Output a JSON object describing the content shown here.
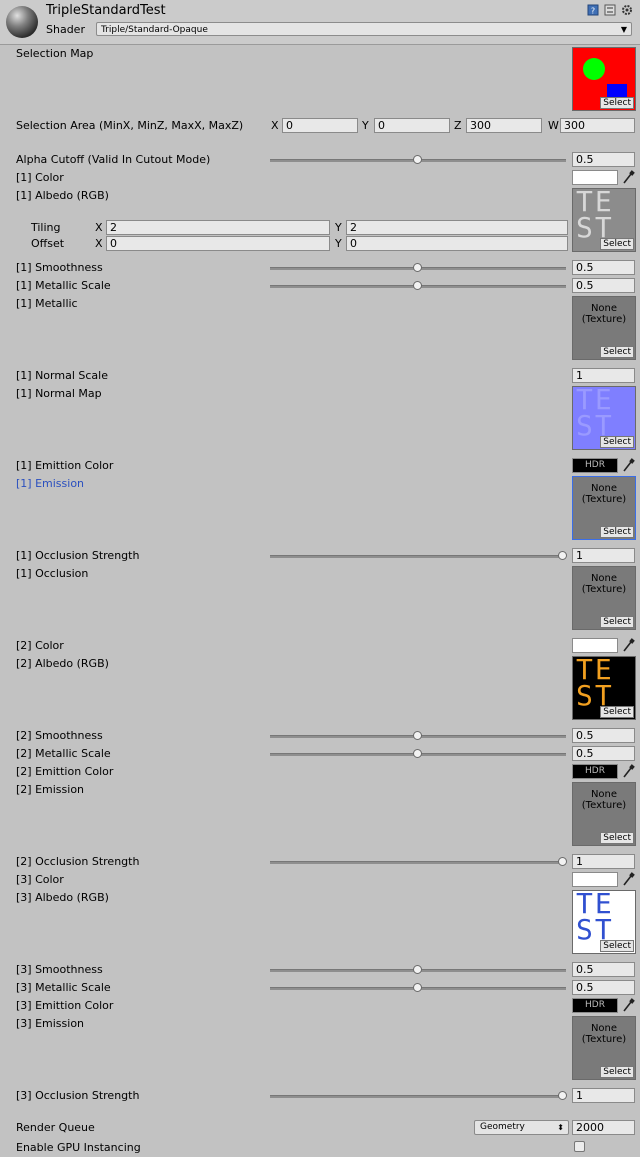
{
  "header": {
    "title": "TripleStandardTest",
    "shader_label": "Shader",
    "shader_value": "Triple/Standard-Opaque"
  },
  "selection_map": {
    "label": "Selection Map",
    "select": "Select"
  },
  "selection_area": {
    "label": "Selection Area (MinX, MinZ, MaxX, MaxZ)",
    "x_axis": "X",
    "x": "0",
    "y_axis": "Y",
    "y": "0",
    "z_axis": "Z",
    "z": "300",
    "w_axis": "W",
    "w": "300"
  },
  "alpha_cutoff": {
    "label": "Alpha Cutoff (Valid In Cutout Mode)",
    "value": "0.5",
    "fraction": 0.5
  },
  "tex_none": "None",
  "tex_texture": "(Texture)",
  "select_label": "Select",
  "hdr_label": "HDR",
  "tiling": {
    "label": "Tiling",
    "x_axis": "X",
    "x": "2",
    "y_axis": "Y",
    "y": "2"
  },
  "offset": {
    "label": "Offset",
    "x_axis": "X",
    "x": "0",
    "y_axis": "Y",
    "y": "0"
  },
  "layer1": {
    "color": "[1] Color",
    "albedo": "[1] Albedo (RGB)",
    "smoothness": "[1] Smoothness",
    "smoothness_value": "0.5",
    "metallic_scale": "[1] Metallic Scale",
    "metallic_scale_value": "0.5",
    "metallic": "[1] Metallic",
    "normal_scale": "[1] Normal Scale",
    "normal_scale_value": "1",
    "normal_map": "[1] Normal Map",
    "emission_color": "[1] Emittion Color",
    "emission": "[1] Emission",
    "occlusion_strength": "[1] Occlusion Strength",
    "occlusion_strength_value": "1",
    "occlusion": "[1] Occlusion"
  },
  "layer2": {
    "color": "[2] Color",
    "albedo": "[2] Albedo (RGB)",
    "smoothness": "[2] Smoothness",
    "smoothness_value": "0.5",
    "metallic_scale": "[2] Metallic Scale",
    "metallic_scale_value": "0.5",
    "emission_color": "[2] Emittion Color",
    "emission": "[2] Emission",
    "occlusion_strength": "[2] Occlusion Strength",
    "occlusion_strength_value": "1"
  },
  "layer3": {
    "color": "[3] Color",
    "albedo": "[3] Albedo (RGB)",
    "smoothness": "[3] Smoothness",
    "smoothness_value": "0.5",
    "metallic_scale": "[3] Metallic Scale",
    "metallic_scale_value": "0.5",
    "emission_color": "[3] Emittion Color",
    "emission": "[3] Emission",
    "occlusion_strength": "[3] Occlusion Strength",
    "occlusion_strength_value": "1"
  },
  "texture_letters": {
    "top": "TE",
    "bottom": "ST"
  },
  "render_queue": {
    "label": "Render Queue",
    "dropdown": "Geometry",
    "value": "2000"
  },
  "gpu_instancing": {
    "label": "Enable GPU Instancing",
    "checked": false
  },
  "colors": {
    "accent_focus": "#3a6ee8",
    "emission_label": "#2a4fbf",
    "map_red": "#ff0000",
    "map_green": "#00ff00",
    "map_blue": "#0000ff",
    "normal_tex": "#7f7fff",
    "albedo2_tex": "#f2a020"
  }
}
